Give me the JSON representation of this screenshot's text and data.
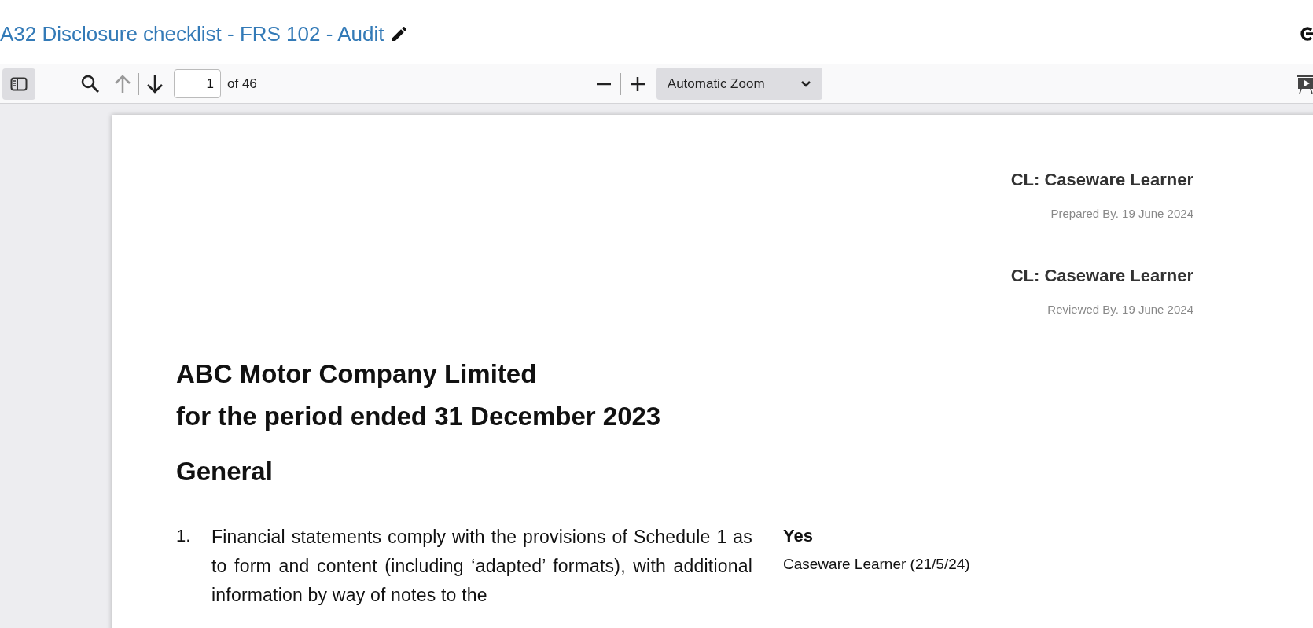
{
  "window": {
    "title": "A32 Disclosure checklist - FRS 102 - Audit"
  },
  "toolbar": {
    "page_number": "1",
    "page_count": "of 46",
    "zoom": "Automatic Zoom",
    "previous_disabled": true
  },
  "document": {
    "signoffs": [
      {
        "name": "CL: Caseware Learner",
        "detail": "Prepared By. 19 June 2024"
      },
      {
        "name": "CL: Caseware Learner",
        "detail": "Reviewed By. 19 June 2024"
      }
    ],
    "heading_lines": [
      "ABC Motor Company Limited",
      "for the period ended 31 December 2023"
    ],
    "section": "General",
    "items": [
      {
        "number": "1.",
        "text": "Financial statements comply with the provisions of Schedule 1 as to form and content (including ‘adapted’ formats), with additional information by way of notes to the",
        "answer": "Yes",
        "answered_by": "Caseware Learner (21/5/24)"
      }
    ]
  }
}
